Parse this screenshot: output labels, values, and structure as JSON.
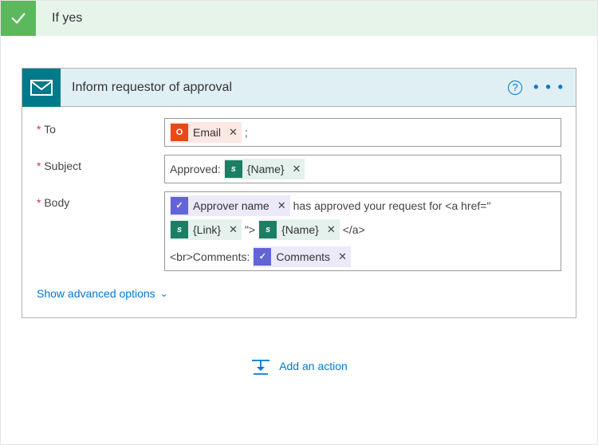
{
  "condition": {
    "label": "If yes"
  },
  "action": {
    "title": "Inform requestor of approval",
    "help": "?",
    "more": "• • •"
  },
  "fields": {
    "to": {
      "label": "To",
      "token_email": "Email",
      "suffix": ";"
    },
    "subject": {
      "label": "Subject",
      "prefix": "Approved:",
      "token_name": "{Name}"
    },
    "body": {
      "label": "Body",
      "token_approver": "Approver name",
      "text1": "has approved your request for <a href=\"",
      "token_link": "{Link}",
      "text2": "\">",
      "token_name": "{Name}",
      "text3": "</a>",
      "text4": "<br>Comments:",
      "token_comments": "Comments"
    }
  },
  "advanced": "Show advanced options",
  "add_action": "Add an action",
  "token_x": "✕"
}
